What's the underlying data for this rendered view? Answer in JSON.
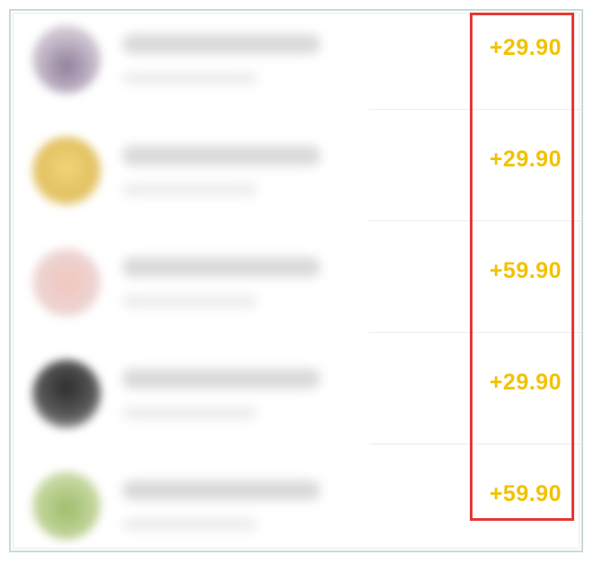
{
  "transactions": [
    {
      "amount": "+29.90"
    },
    {
      "amount": "+29.90"
    },
    {
      "amount": "+59.90"
    },
    {
      "amount": "+29.90"
    },
    {
      "amount": "+59.90"
    }
  ],
  "colors": {
    "amount": "#f2c200",
    "highlight_border": "#e53935",
    "frame_border": "#c9dcd4"
  }
}
